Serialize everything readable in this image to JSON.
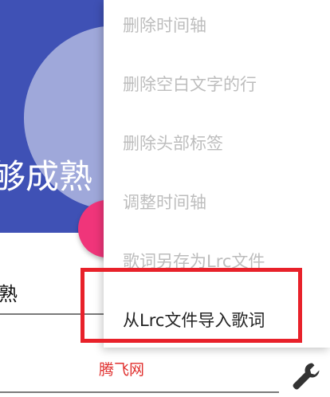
{
  "app": {
    "title_partial": "够成熟",
    "input_partial": "熟"
  },
  "menu": {
    "items": [
      {
        "label": "删除时间轴",
        "enabled": false
      },
      {
        "label": "删除空白文字的行",
        "enabled": false
      },
      {
        "label": "删除头部标签",
        "enabled": false
      },
      {
        "label": "调整时间轴",
        "enabled": false
      },
      {
        "label": "歌词另存为Lrc文件",
        "enabled": false
      },
      {
        "label": "从Lrc文件导入歌词",
        "enabled": true
      }
    ]
  },
  "watermark": "腾飞网",
  "colors": {
    "header": "#3f51b5",
    "header_circle": "#9fa8da",
    "fab": "#f0357a",
    "highlight": "#e8212a",
    "watermark": "#e0312f"
  },
  "icons": {
    "settings": "wrench-icon"
  }
}
